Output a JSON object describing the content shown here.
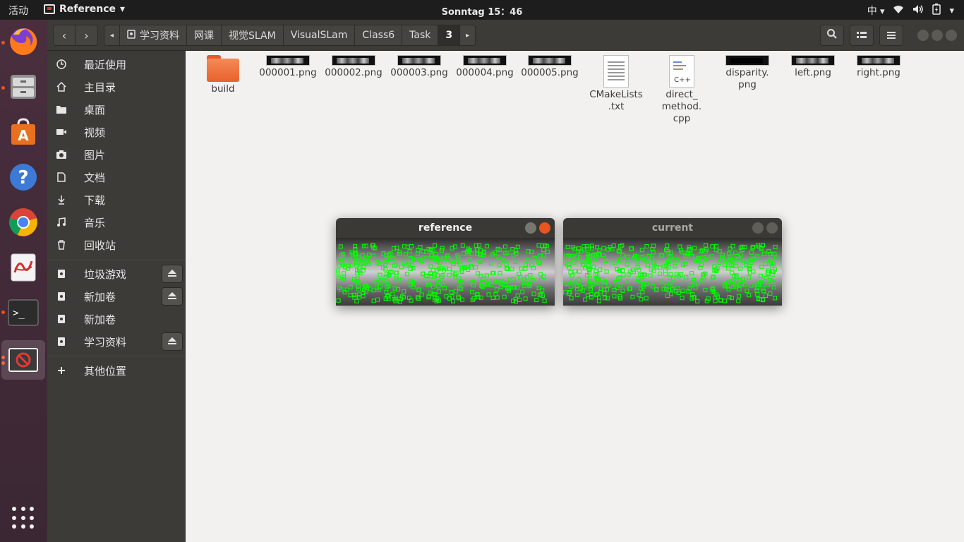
{
  "topbar": {
    "activities": "活动",
    "app_name": "Reference",
    "app_menu_arrow": "▾",
    "clock": "Sonntag 15：46",
    "ime": "中",
    "ime_arrow": "▾",
    "tray_arrow": "▾"
  },
  "dock": {
    "items": [
      "firefox-icon",
      "file-cabinet-icon",
      "software-store-icon",
      "help-icon",
      "chrome-icon",
      "document-viewer-icon",
      "terminal-icon",
      "blocked-window-icon"
    ]
  },
  "header": {
    "back": "‹",
    "forward": "›",
    "crumb_left_arrow": "◂",
    "crumbs": [
      "学习资料",
      "网课",
      "视觉SLAM",
      "VisualSLam",
      "Class6",
      "Task",
      "3"
    ],
    "crumb_right_arrow": "▸"
  },
  "sidebar": {
    "items": [
      "最近使用",
      "主目录",
      "桌面",
      "视频",
      "图片",
      "文档",
      "下载",
      "音乐",
      "回收站"
    ],
    "devices": [
      "垃圾游戏",
      "新加卷",
      "新加卷",
      "学习资料"
    ],
    "other": "其他位置"
  },
  "files": [
    {
      "name": "build",
      "type": "folder"
    },
    {
      "name": "000001.png",
      "type": "image"
    },
    {
      "name": "000002.png",
      "type": "image"
    },
    {
      "name": "000003.png",
      "type": "image"
    },
    {
      "name": "000004.png",
      "type": "image"
    },
    {
      "name": "000005.png",
      "type": "image"
    },
    {
      "name": "CMakeLists\n.txt",
      "type": "text"
    },
    {
      "name": "direct_\nmethod.\ncpp",
      "type": "cpp"
    },
    {
      "name": "disparity.\npng",
      "type": "image-dark"
    },
    {
      "name": "left.png",
      "type": "image"
    },
    {
      "name": "right.png",
      "type": "image"
    }
  ],
  "cv_windows": [
    {
      "title": "reference",
      "active": true
    },
    {
      "title": "current",
      "active": false
    }
  ],
  "colors": {
    "accent": "#e95420",
    "feature": "#00ff00",
    "close_active": "#e9541f"
  }
}
